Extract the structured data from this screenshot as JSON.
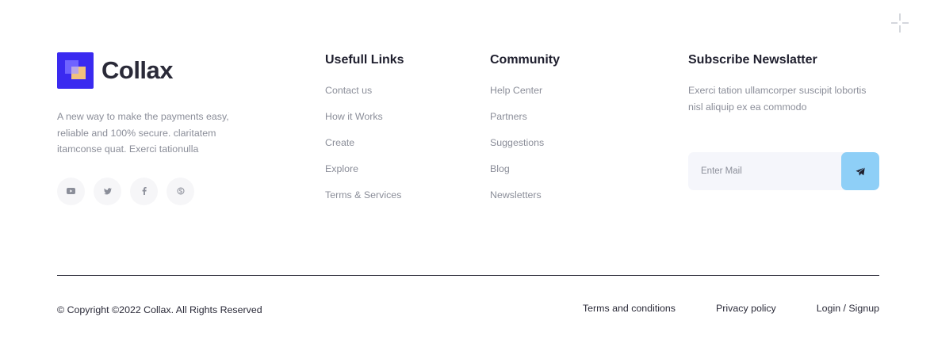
{
  "brand": {
    "name": "Collax",
    "description": "A new way to make the payments easy, reliable and 100% secure. claritatem itamconse quat. Exerci tationulla",
    "socials": [
      {
        "icon": "youtube-icon"
      },
      {
        "icon": "twitter-icon"
      },
      {
        "icon": "facebook-icon"
      },
      {
        "icon": "skype-icon"
      }
    ]
  },
  "useful_links": {
    "title": "Usefull Links",
    "items": [
      "Contact us",
      "How it Works",
      "Create",
      "Explore",
      "Terms & Services"
    ]
  },
  "community": {
    "title": "Community",
    "items": [
      "Help Center",
      "Partners",
      "Suggestions",
      "Blog",
      "Newsletters"
    ]
  },
  "newsletter": {
    "title": "Subscribe Newslatter",
    "description": "Exerci tation ullamcorper suscipit lobortis nisl aliquip ex ea commodo",
    "placeholder": "Enter Mail",
    "submit_icon": "send-icon"
  },
  "footer": {
    "copyright": "© Copyright ©2022 Collax. All Rights Reserved",
    "links": [
      "Terms and conditions",
      "Privacy policy",
      "Login / Signup"
    ]
  },
  "colors": {
    "brand": "#3a2af0",
    "submit": "#8ecff7",
    "muted_text": "#8b8e99"
  }
}
